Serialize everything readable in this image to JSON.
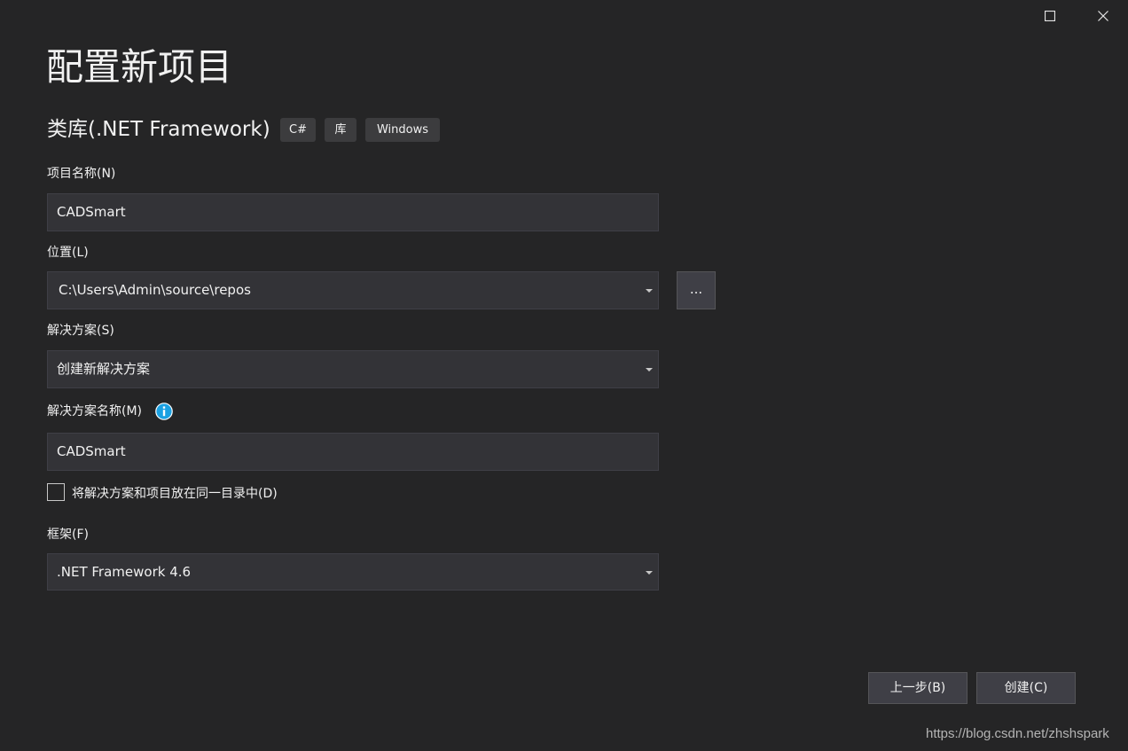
{
  "window": {
    "maximize_icon": "maximize-icon",
    "close_icon": "close-icon"
  },
  "header": {
    "title": "配置新项目",
    "template_name": "类库(.NET Framework)",
    "tags": [
      "C#",
      "库",
      "Windows"
    ]
  },
  "form": {
    "project_name": {
      "label": "项目名称(N)",
      "value": "CADSmart"
    },
    "location": {
      "label": "位置(L)",
      "value": "C:\\Users\\Admin\\source\\repos",
      "browse_label": "..."
    },
    "solution": {
      "label": "解决方案(S)",
      "value": "创建新解决方案"
    },
    "solution_name": {
      "label": "解决方案名称(M)",
      "value": "CADSmart",
      "info_icon": "info-icon"
    },
    "same_directory": {
      "label": "将解决方案和项目放在同一目录中(D)",
      "checked": false
    },
    "framework": {
      "label": "框架(F)",
      "value": ".NET Framework 4.6"
    }
  },
  "footer": {
    "back_label": "上一步(B)",
    "create_label": "创建(C)"
  },
  "watermark": "https://blog.csdn.net/zhshspark",
  "colors": {
    "background": "#252526",
    "input_background": "#333337",
    "border": "#3f3f46",
    "button_background": "#3f3f46",
    "text": "#f1f1f1",
    "info_accent": "#1ba1e2"
  }
}
